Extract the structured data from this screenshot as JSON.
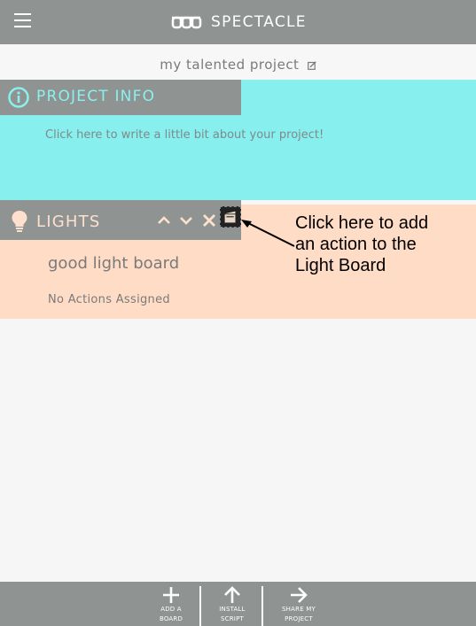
{
  "app": {
    "name": "SPECTACLE"
  },
  "project": {
    "title": "my talented project"
  },
  "project_info": {
    "header": "PROJECT INFO",
    "description_prompt": "Click here to write a little bit about your project!"
  },
  "lights_board": {
    "header": "LIGHTS",
    "board_name": "good light board",
    "actions_status": "No Actions Assigned"
  },
  "callout": {
    "line1": "Click here to add",
    "line2": "an action to the",
    "line3": "Light Board"
  },
  "bottom_bar": {
    "add_board": {
      "line1": "ADD A",
      "line2": "BOARD"
    },
    "install_script": {
      "line1": "INSTALL",
      "line2": "SCRIPT"
    },
    "share_project": {
      "line1": "SHARE MY",
      "line2": "PROJECT"
    }
  },
  "colors": {
    "bar": "#8f9492",
    "project_info_bg": "#87f0ee",
    "lights_bg": "#ffdcc6"
  },
  "icons": [
    "menu-icon",
    "glasses-logo-icon",
    "edit-icon",
    "info-icon",
    "lightbulb-icon",
    "chevron-up-icon",
    "chevron-down-icon",
    "close-icon",
    "add-action-icon",
    "plus-icon",
    "arrow-up-icon",
    "arrow-right-icon"
  ]
}
